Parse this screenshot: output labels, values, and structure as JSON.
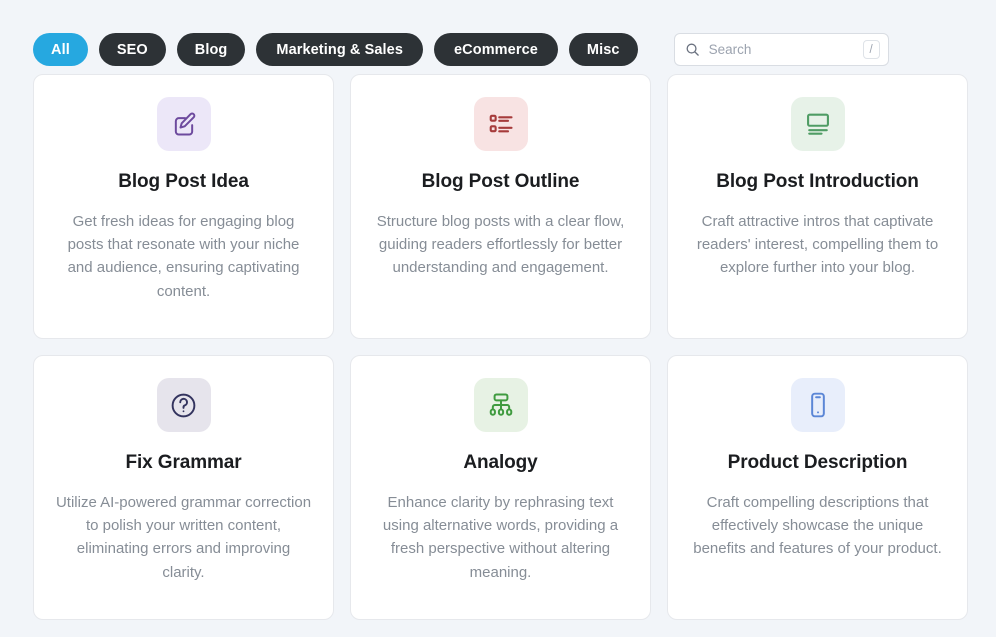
{
  "filters": {
    "chips": [
      {
        "label": "All",
        "active": true
      },
      {
        "label": "SEO",
        "active": false
      },
      {
        "label": "Blog",
        "active": false
      },
      {
        "label": "Marketing & Sales",
        "active": false
      },
      {
        "label": "eCommerce",
        "active": false
      },
      {
        "label": "Misc",
        "active": false
      }
    ],
    "active_color": "#26a8e0",
    "inactive_color": "#2d3236"
  },
  "search": {
    "placeholder": "Search",
    "value": "",
    "shortcut": "/",
    "icon": "search-icon"
  },
  "cards": [
    {
      "title": "Blog Post Idea",
      "description": "Get fresh ideas for engaging blog posts that resonate with your niche and audience, ensuring captivating content.",
      "icon": "edit-pencil-square-icon",
      "icon_color": "#6d4a9e",
      "tile_color": "#ece7f8"
    },
    {
      "title": "Blog Post Outline",
      "description": "Structure blog posts with a clear flow, guiding readers effortlessly for better understanding and engagement.",
      "icon": "list-outline-icon",
      "icon_color": "#a63b3b",
      "tile_color": "#f8e3e3"
    },
    {
      "title": "Blog Post Introduction",
      "description": "Craft attractive intros that captivate readers' interest, compelling them to explore further into your blog.",
      "icon": "presentation-article-icon",
      "icon_color": "#4f9c64",
      "tile_color": "#e7f2e8"
    },
    {
      "title": "Fix Grammar",
      "description": "Utilize AI-powered grammar correction to polish your written content, eliminating errors and improving clarity.",
      "icon": "question-circle-icon",
      "icon_color": "#33335e",
      "tile_color": "#e6e4ec"
    },
    {
      "title": "Analogy",
      "description": "Enhance clarity by rephrasing text using alternative words, providing a fresh perspective without altering meaning.",
      "icon": "sitemap-hierarchy-icon",
      "icon_color": "#3f9b3f",
      "tile_color": "#e7f2e4"
    },
    {
      "title": "Product Description",
      "description": "Craft compelling descriptions that effectively showcase the unique benefits and features of your product.",
      "icon": "mobile-device-icon",
      "icon_color": "#5b86d6",
      "tile_color": "#e8eefb"
    }
  ]
}
